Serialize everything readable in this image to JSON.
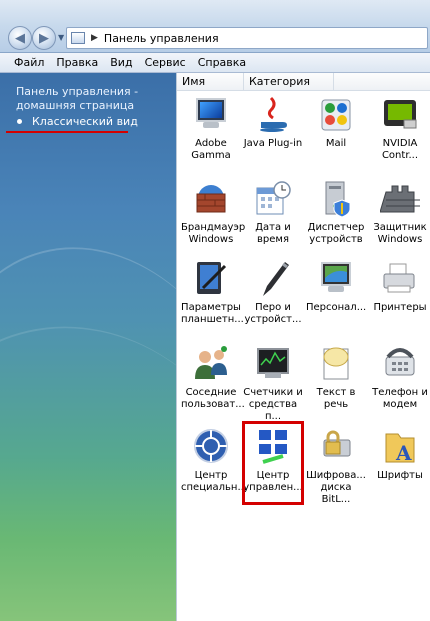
{
  "address": {
    "path": "Панель управления"
  },
  "menu": [
    "Файл",
    "Правка",
    "Вид",
    "Сервис",
    "Справка"
  ],
  "sidebar": {
    "home_link": "Панель управления - домашняя страница",
    "classic_link": "Классический вид"
  },
  "columns": {
    "name": "Имя",
    "category": "Категория"
  },
  "items": [
    {
      "label": "Adobe Gamma",
      "icon": "monitor-icon"
    },
    {
      "label": "Java Plug-in",
      "icon": "java-icon"
    },
    {
      "label": "Mail",
      "icon": "mail-icon"
    },
    {
      "label": "NVIDIA Contr...",
      "icon": "nvidia-icon"
    },
    {
      "label": "Брандмауэр Windows",
      "icon": "firewall-icon"
    },
    {
      "label": "Дата и время",
      "icon": "calendar-clock-icon"
    },
    {
      "label": "Диспетчер устройств",
      "icon": "device-manager-icon"
    },
    {
      "label": "Защитник Windows",
      "icon": "defender-icon"
    },
    {
      "label": "Параметры планшетн...",
      "icon": "tablet-icon"
    },
    {
      "label": "Перо и устройст...",
      "icon": "pen-icon"
    },
    {
      "label": "Персонал...",
      "icon": "personalization-icon"
    },
    {
      "label": "Принтеры",
      "icon": "printer-icon"
    },
    {
      "label": "Соседние пользоват...",
      "icon": "people-near-me-icon"
    },
    {
      "label": "Счетчики и средства п...",
      "icon": "performance-icon"
    },
    {
      "label": "Текст в речь",
      "icon": "speech-icon"
    },
    {
      "label": "Телефон и модем",
      "icon": "phone-icon"
    },
    {
      "label": "Центр специальн...",
      "icon": "ease-of-access-icon"
    },
    {
      "label": "Центр управлен...",
      "icon": "network-center-icon"
    },
    {
      "label": "Шифрова... диска BitL...",
      "icon": "bitlocker-icon"
    },
    {
      "label": "Шрифты",
      "icon": "fonts-icon"
    }
  ]
}
